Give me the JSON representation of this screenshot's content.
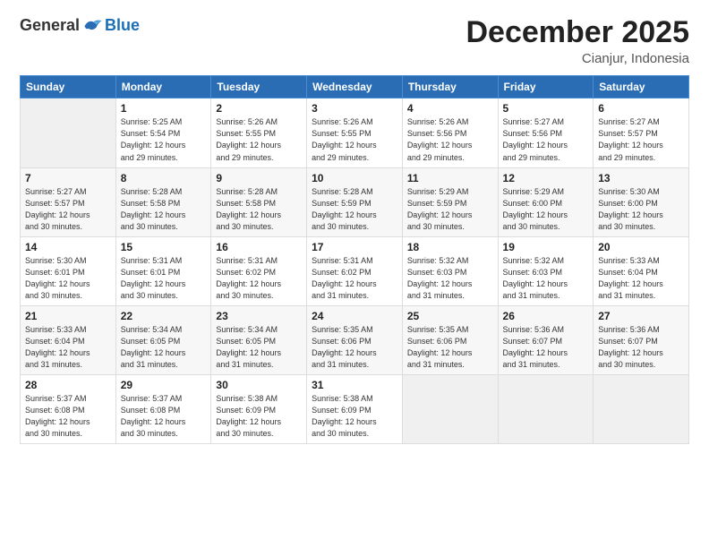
{
  "header": {
    "logo_general": "General",
    "logo_blue": "Blue",
    "month": "December 2025",
    "location": "Cianjur, Indonesia"
  },
  "weekdays": [
    "Sunday",
    "Monday",
    "Tuesday",
    "Wednesday",
    "Thursday",
    "Friday",
    "Saturday"
  ],
  "weeks": [
    [
      {
        "day": "",
        "info": ""
      },
      {
        "day": "1",
        "info": "Sunrise: 5:25 AM\nSunset: 5:54 PM\nDaylight: 12 hours\nand 29 minutes."
      },
      {
        "day": "2",
        "info": "Sunrise: 5:26 AM\nSunset: 5:55 PM\nDaylight: 12 hours\nand 29 minutes."
      },
      {
        "day": "3",
        "info": "Sunrise: 5:26 AM\nSunset: 5:55 PM\nDaylight: 12 hours\nand 29 minutes."
      },
      {
        "day": "4",
        "info": "Sunrise: 5:26 AM\nSunset: 5:56 PM\nDaylight: 12 hours\nand 29 minutes."
      },
      {
        "day": "5",
        "info": "Sunrise: 5:27 AM\nSunset: 5:56 PM\nDaylight: 12 hours\nand 29 minutes."
      },
      {
        "day": "6",
        "info": "Sunrise: 5:27 AM\nSunset: 5:57 PM\nDaylight: 12 hours\nand 29 minutes."
      }
    ],
    [
      {
        "day": "7",
        "info": "Sunrise: 5:27 AM\nSunset: 5:57 PM\nDaylight: 12 hours\nand 30 minutes."
      },
      {
        "day": "8",
        "info": "Sunrise: 5:28 AM\nSunset: 5:58 PM\nDaylight: 12 hours\nand 30 minutes."
      },
      {
        "day": "9",
        "info": "Sunrise: 5:28 AM\nSunset: 5:58 PM\nDaylight: 12 hours\nand 30 minutes."
      },
      {
        "day": "10",
        "info": "Sunrise: 5:28 AM\nSunset: 5:59 PM\nDaylight: 12 hours\nand 30 minutes."
      },
      {
        "day": "11",
        "info": "Sunrise: 5:29 AM\nSunset: 5:59 PM\nDaylight: 12 hours\nand 30 minutes."
      },
      {
        "day": "12",
        "info": "Sunrise: 5:29 AM\nSunset: 6:00 PM\nDaylight: 12 hours\nand 30 minutes."
      },
      {
        "day": "13",
        "info": "Sunrise: 5:30 AM\nSunset: 6:00 PM\nDaylight: 12 hours\nand 30 minutes."
      }
    ],
    [
      {
        "day": "14",
        "info": "Sunrise: 5:30 AM\nSunset: 6:01 PM\nDaylight: 12 hours\nand 30 minutes."
      },
      {
        "day": "15",
        "info": "Sunrise: 5:31 AM\nSunset: 6:01 PM\nDaylight: 12 hours\nand 30 minutes."
      },
      {
        "day": "16",
        "info": "Sunrise: 5:31 AM\nSunset: 6:02 PM\nDaylight: 12 hours\nand 30 minutes."
      },
      {
        "day": "17",
        "info": "Sunrise: 5:31 AM\nSunset: 6:02 PM\nDaylight: 12 hours\nand 31 minutes."
      },
      {
        "day": "18",
        "info": "Sunrise: 5:32 AM\nSunset: 6:03 PM\nDaylight: 12 hours\nand 31 minutes."
      },
      {
        "day": "19",
        "info": "Sunrise: 5:32 AM\nSunset: 6:03 PM\nDaylight: 12 hours\nand 31 minutes."
      },
      {
        "day": "20",
        "info": "Sunrise: 5:33 AM\nSunset: 6:04 PM\nDaylight: 12 hours\nand 31 minutes."
      }
    ],
    [
      {
        "day": "21",
        "info": "Sunrise: 5:33 AM\nSunset: 6:04 PM\nDaylight: 12 hours\nand 31 minutes."
      },
      {
        "day": "22",
        "info": "Sunrise: 5:34 AM\nSunset: 6:05 PM\nDaylight: 12 hours\nand 31 minutes."
      },
      {
        "day": "23",
        "info": "Sunrise: 5:34 AM\nSunset: 6:05 PM\nDaylight: 12 hours\nand 31 minutes."
      },
      {
        "day": "24",
        "info": "Sunrise: 5:35 AM\nSunset: 6:06 PM\nDaylight: 12 hours\nand 31 minutes."
      },
      {
        "day": "25",
        "info": "Sunrise: 5:35 AM\nSunset: 6:06 PM\nDaylight: 12 hours\nand 31 minutes."
      },
      {
        "day": "26",
        "info": "Sunrise: 5:36 AM\nSunset: 6:07 PM\nDaylight: 12 hours\nand 31 minutes."
      },
      {
        "day": "27",
        "info": "Sunrise: 5:36 AM\nSunset: 6:07 PM\nDaylight: 12 hours\nand 30 minutes."
      }
    ],
    [
      {
        "day": "28",
        "info": "Sunrise: 5:37 AM\nSunset: 6:08 PM\nDaylight: 12 hours\nand 30 minutes."
      },
      {
        "day": "29",
        "info": "Sunrise: 5:37 AM\nSunset: 6:08 PM\nDaylight: 12 hours\nand 30 minutes."
      },
      {
        "day": "30",
        "info": "Sunrise: 5:38 AM\nSunset: 6:09 PM\nDaylight: 12 hours\nand 30 minutes."
      },
      {
        "day": "31",
        "info": "Sunrise: 5:38 AM\nSunset: 6:09 PM\nDaylight: 12 hours\nand 30 minutes."
      },
      {
        "day": "",
        "info": ""
      },
      {
        "day": "",
        "info": ""
      },
      {
        "day": "",
        "info": ""
      }
    ]
  ]
}
